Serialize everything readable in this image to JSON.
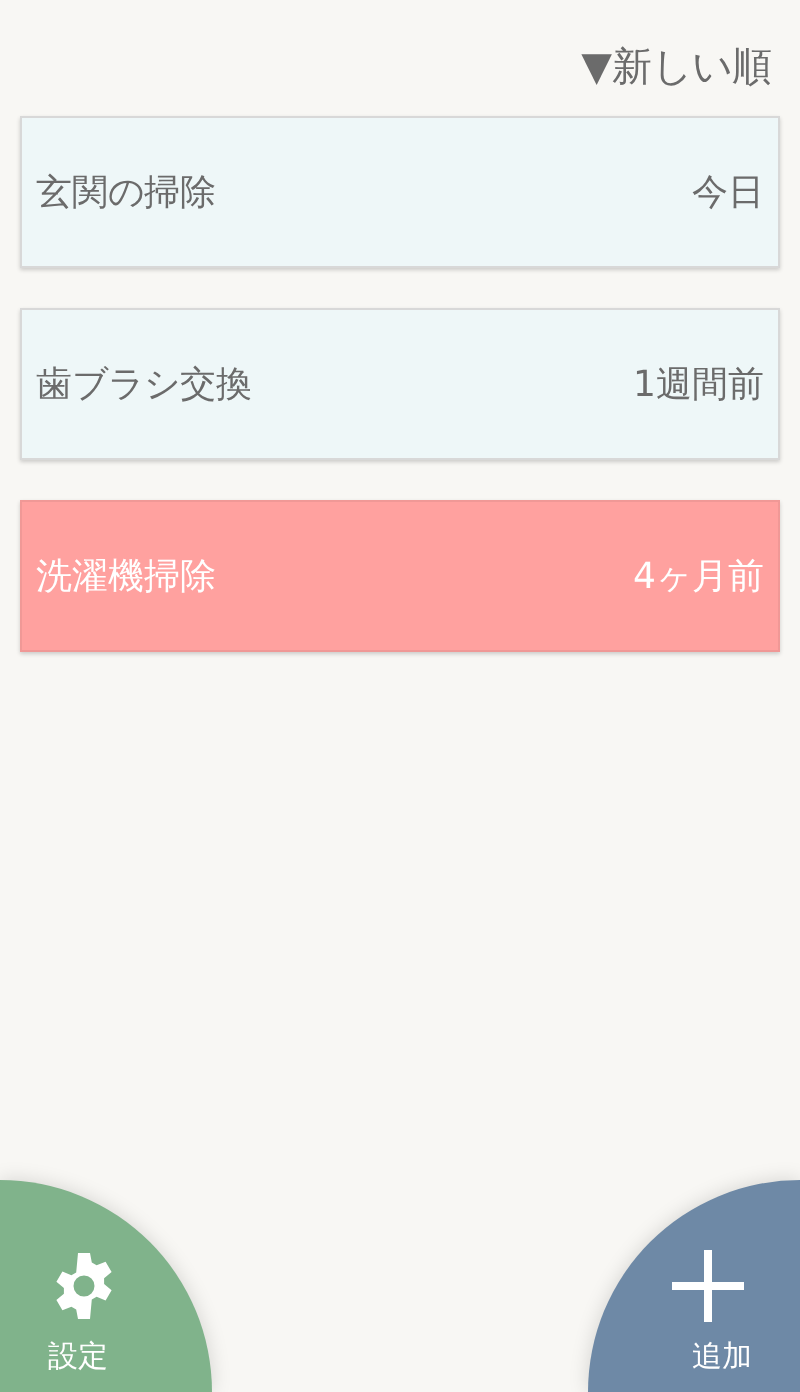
{
  "sort": {
    "label": "▼新しい順"
  },
  "tasks": [
    {
      "name": "玄関の掃除",
      "elapsed": "今日",
      "color": "#eef7f8"
    },
    {
      "name": "歯ブラシ交換",
      "elapsed": "1週間前",
      "color": "#eef7f8"
    },
    {
      "name": "洗濯機掃除",
      "elapsed": "4ヶ月前",
      "color": "#ffa19f"
    }
  ],
  "settings_button": {
    "label": "設定"
  },
  "add_button": {
    "label": "追加"
  }
}
